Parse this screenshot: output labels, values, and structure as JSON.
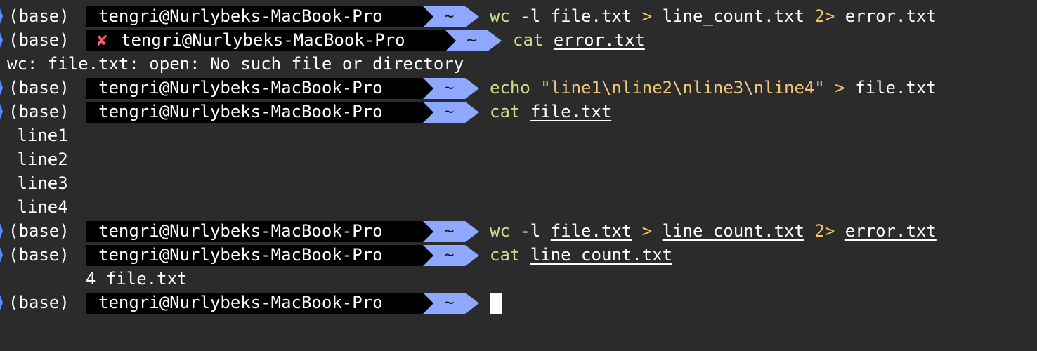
{
  "prompt": {
    "env": "(base)",
    "host": "tengri@Nurlybeks-MacBook-Pro",
    "dir": "~"
  },
  "lines": [
    {
      "type": "prompt",
      "error": false,
      "cmd": [
        {
          "t": "wc",
          "k": "bin"
        },
        {
          "t": " -l ",
          "k": "arg"
        },
        {
          "t": "file.txt",
          "k": "arg"
        },
        {
          "t": " > ",
          "k": "red"
        },
        {
          "t": "line_count.txt",
          "k": "arg"
        },
        {
          "t": " 2> ",
          "k": "red"
        },
        {
          "t": "error.txt",
          "k": "arg"
        }
      ]
    },
    {
      "type": "prompt",
      "error": true,
      "cmd": [
        {
          "t": "cat",
          "k": "bin"
        },
        {
          "t": " ",
          "k": "arg"
        },
        {
          "t": "error.txt",
          "k": "file"
        }
      ]
    },
    {
      "type": "output",
      "text": "wc: file.txt: open: No such file or directory"
    },
    {
      "type": "prompt",
      "error": false,
      "cmd": [
        {
          "t": "echo",
          "k": "bin"
        },
        {
          "t": " ",
          "k": "arg"
        },
        {
          "t": "\"line1\\nline2\\nline3\\nline4\"",
          "k": "str"
        },
        {
          "t": " > ",
          "k": "red"
        },
        {
          "t": "file.txt",
          "k": "arg"
        }
      ]
    },
    {
      "type": "prompt",
      "error": false,
      "cmd": [
        {
          "t": "cat",
          "k": "bin"
        },
        {
          "t": " ",
          "k": "arg"
        },
        {
          "t": "file.txt",
          "k": "file"
        }
      ]
    },
    {
      "type": "output",
      "text": " line1"
    },
    {
      "type": "output",
      "text": " line2"
    },
    {
      "type": "output",
      "text": " line3"
    },
    {
      "type": "output",
      "text": " line4"
    },
    {
      "type": "prompt",
      "error": false,
      "cmd": [
        {
          "t": "wc",
          "k": "bin"
        },
        {
          "t": " -l ",
          "k": "arg"
        },
        {
          "t": "file.txt",
          "k": "file"
        },
        {
          "t": " > ",
          "k": "red"
        },
        {
          "t": "line_count.txt",
          "k": "file"
        },
        {
          "t": " 2> ",
          "k": "red"
        },
        {
          "t": "error.txt",
          "k": "file"
        }
      ]
    },
    {
      "type": "prompt",
      "error": false,
      "cmd": [
        {
          "t": "cat",
          "k": "bin"
        },
        {
          "t": " ",
          "k": "arg"
        },
        {
          "t": "line_count.txt",
          "k": "file"
        }
      ]
    },
    {
      "type": "output",
      "indent": true,
      "text": "4 file.txt"
    },
    {
      "type": "prompt",
      "error": false,
      "cursor": true,
      "cmd": []
    }
  ],
  "icons": {
    "error": "✘",
    "prompt_marker": "right-arrow-icon"
  },
  "colors": {
    "background": "#2b2b2b",
    "host_segment": "#000000",
    "dir_segment": "#8fa8ff",
    "command": "#c8e089",
    "redirect": "#f5c166",
    "error_icon": "#ff5f6d"
  }
}
